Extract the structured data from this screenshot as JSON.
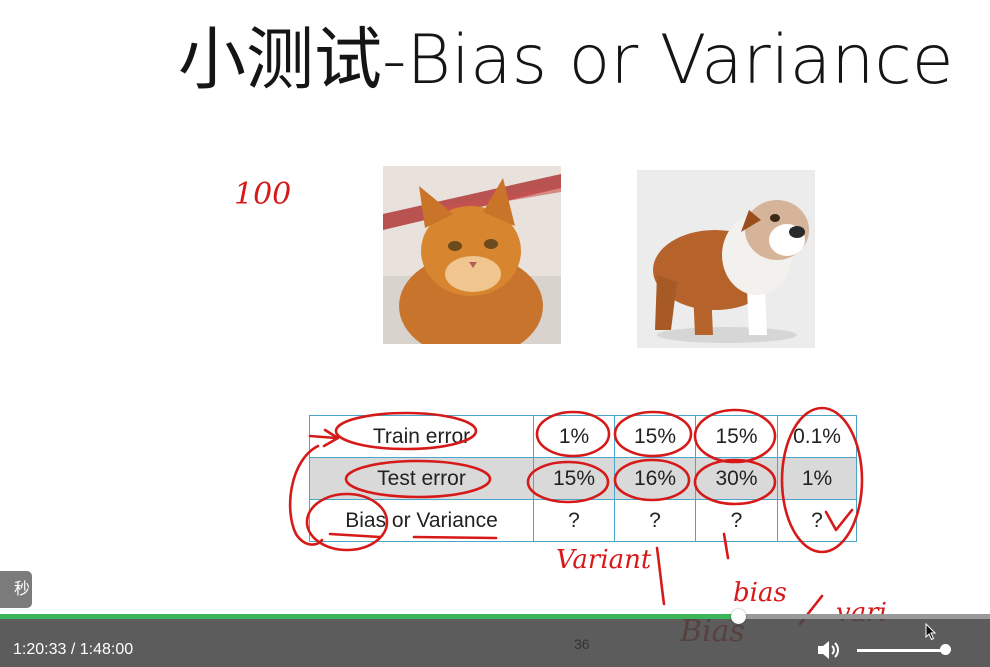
{
  "slide": {
    "title": "小测试-Bias or Variance",
    "page_number": "36"
  },
  "table": {
    "rows": [
      {
        "label": "Train error",
        "values": [
          "1%",
          "15%",
          "15%",
          "0.1%"
        ],
        "shaded": false
      },
      {
        "label": "Test error",
        "values": [
          "15%",
          "16%",
          "30%",
          "1%"
        ],
        "shaded": true
      },
      {
        "label": "Bias or Variance",
        "values": [
          "?",
          "?",
          "?",
          "?"
        ],
        "shaded": false
      }
    ]
  },
  "annotations": {
    "note_100": "100",
    "note_variant": "Variant",
    "note_bias_top": "bias",
    "note_bias_bottom": "Bias",
    "note_vari": "vari"
  },
  "overlay": {
    "toast": "秒"
  },
  "player": {
    "current_time": "1:20:33",
    "separator": "/",
    "duration": "1:48:00",
    "progress": 0.745,
    "volume": 1.0,
    "colors": {
      "progress": "#3cb45a",
      "ink": "#d61919"
    }
  },
  "icons": {
    "volume": "volume-icon",
    "cursor": "mouse-cursor-icon"
  }
}
